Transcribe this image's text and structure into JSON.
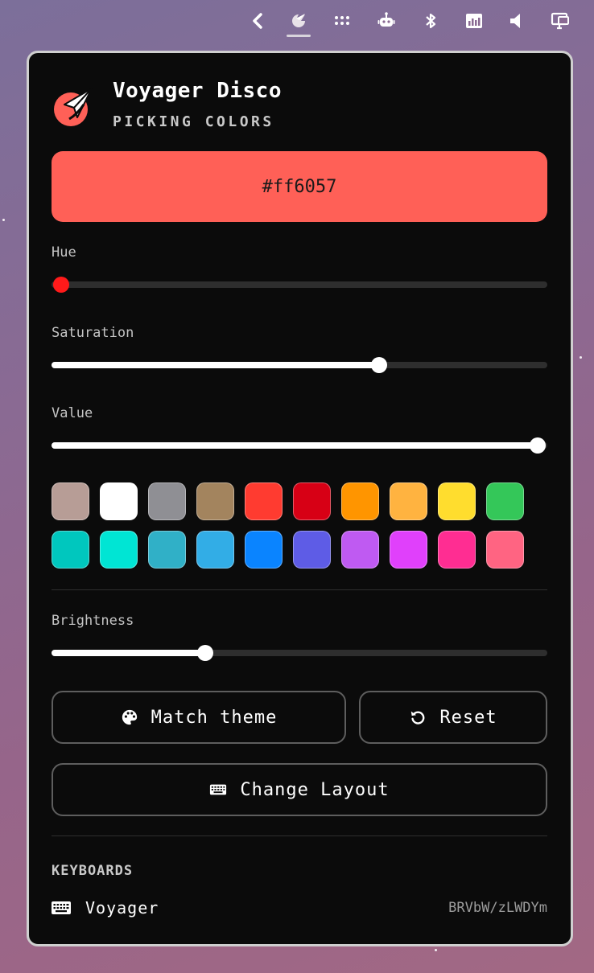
{
  "topbar": {
    "icons": [
      "chevron-left-icon",
      "keyboard-app-icon",
      "dots-grid-icon",
      "robot-icon",
      "bluetooth-icon",
      "network-icon",
      "volume-icon",
      "display-icon"
    ]
  },
  "app": {
    "title": "Voyager Disco",
    "subtitle": "PICKING COLORS"
  },
  "color": {
    "hex": "#ff6057"
  },
  "sliders": {
    "hue": {
      "label": "Hue",
      "value": 0.02
    },
    "saturation": {
      "label": "Saturation",
      "value": 0.66
    },
    "value": {
      "label": "Value",
      "value": 0.98
    },
    "brightness": {
      "label": "Brightness",
      "value": 0.31
    }
  },
  "swatches": [
    [
      "#b79d96",
      "#ffffff",
      "#8f8f94",
      "#a3845e",
      "#ff3b30",
      "#d70015",
      "#ff9500",
      "#ffb340",
      "#ffdd2e",
      "#34c759"
    ],
    [
      "#00c7be",
      "#00e5d4",
      "#30b0c7",
      "#32ade6",
      "#0a84ff",
      "#5e5ce6",
      "#bf5af2",
      "#e040fb",
      "#ff2d92",
      "#ff6482"
    ]
  ],
  "buttons": {
    "match_theme": "Match theme",
    "reset": "Reset",
    "change_layout": "Change Layout"
  },
  "keyboards": {
    "heading": "KEYBOARDS",
    "items": [
      {
        "name": "Voyager",
        "id": "BRVbW/zLWDYm"
      }
    ]
  }
}
